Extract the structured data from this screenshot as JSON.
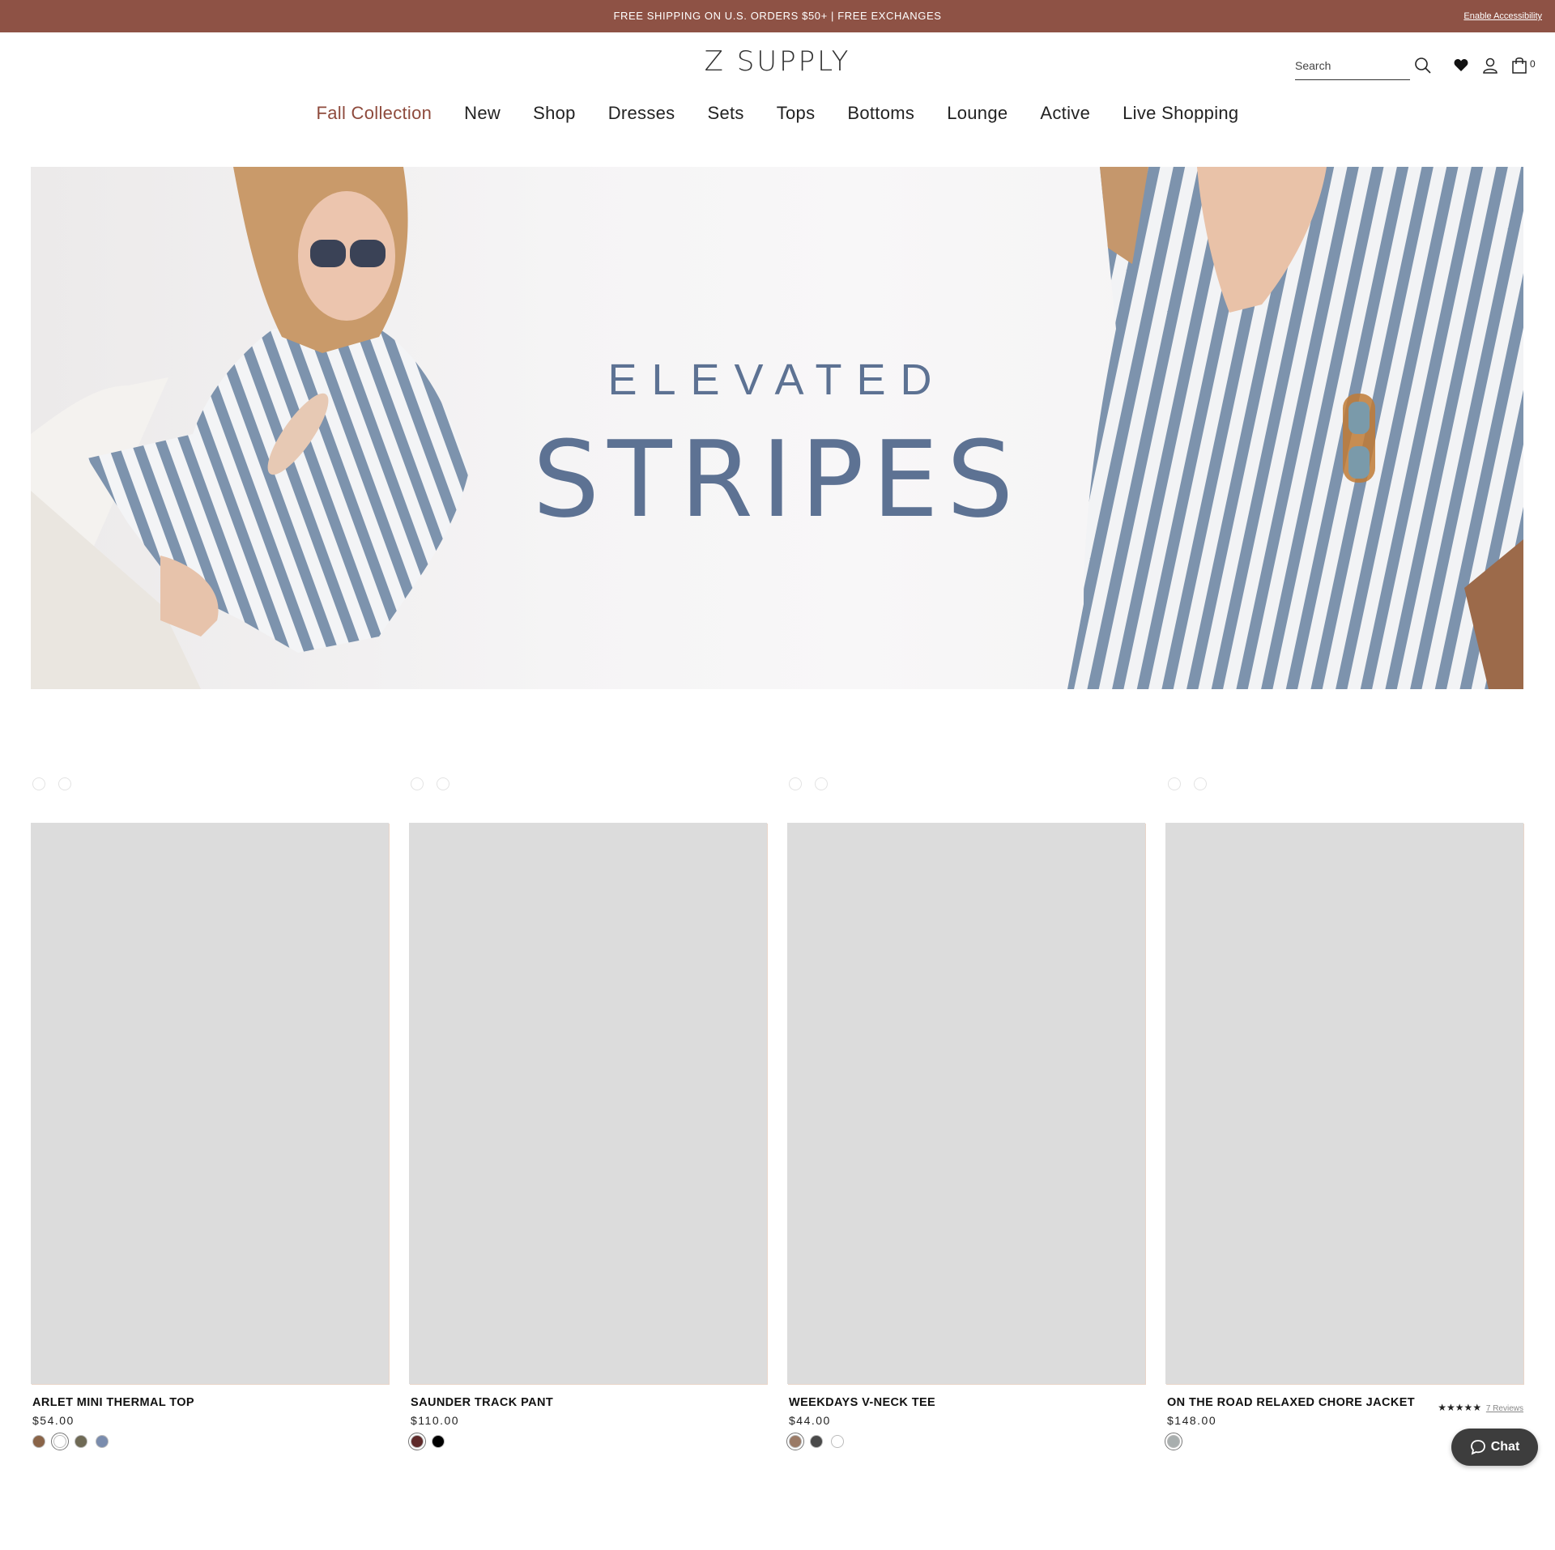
{
  "announcement": {
    "message": "FREE SHIPPING ON U.S. ORDERS $50+ | FREE EXCHANGES",
    "accessibility_link": "Enable Accessibility",
    "bg_color": "#8e5245"
  },
  "header": {
    "logo": "Z SUPPLY",
    "search_placeholder": "Search",
    "cart_count": "0",
    "icons": [
      "search-icon",
      "heart-icon",
      "account-icon",
      "bag-icon"
    ]
  },
  "nav": {
    "items": [
      {
        "label": "Fall Collection",
        "active": true
      },
      {
        "label": "New"
      },
      {
        "label": "Shop"
      },
      {
        "label": "Dresses"
      },
      {
        "label": "Sets"
      },
      {
        "label": "Tops"
      },
      {
        "label": "Bottoms"
      },
      {
        "label": "Lounge"
      },
      {
        "label": "Active"
      },
      {
        "label": "Live Shopping"
      }
    ],
    "active_color": "#8e4a3c"
  },
  "hero": {
    "line1": "ELEVATED",
    "line2": "STRIPES",
    "text_color": "#5d7293"
  },
  "products": [
    {
      "name": "ARLET MINI THERMAL TOP",
      "price": "$54.00",
      "swatches": [
        "#8a6448",
        "#ffffff",
        "#6f6a55",
        "#7a8cad"
      ],
      "selected": 1
    },
    {
      "name": "SAUNDER TRACK PANT",
      "price": "$110.00",
      "swatches": [
        "#5e2a2a",
        "#000000"
      ],
      "selected": 0
    },
    {
      "name": "WEEKDAYS V-NECK TEE",
      "price": "$44.00",
      "swatches": [
        "#9a7a66",
        "#4a4a4a",
        "#ffffff"
      ],
      "selected": 0
    },
    {
      "name": "ON THE ROAD RELAXED CHORE JACKET",
      "price": "$148.00",
      "swatches": [
        "#a8aeae"
      ],
      "selected": 0,
      "stars": "★★★★★",
      "reviews": "7 Reviews"
    }
  ],
  "chat": {
    "label": "Chat"
  }
}
